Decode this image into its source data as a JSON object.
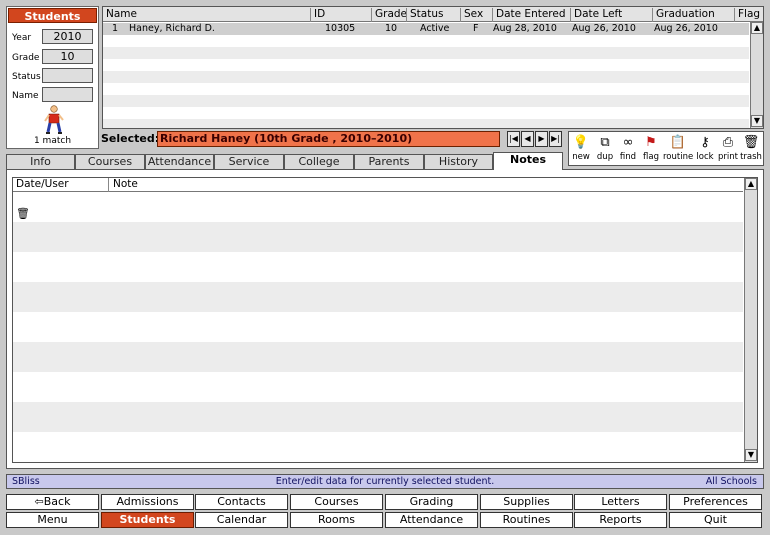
{
  "students_panel": {
    "title": "Students",
    "year_label": "Year",
    "year_value": "2010",
    "grade_label": "Grade",
    "grade_value": "10",
    "status_label": "Status",
    "status_value": "",
    "name_label": "Name",
    "name_value": "",
    "match_text": "1 match",
    "icon": "person-figure-icon"
  },
  "student_list": {
    "columns": [
      "Name",
      "ID",
      "Grade",
      "Status",
      "Sex",
      "Date Entered",
      "Date Left",
      "Graduation",
      "Flag"
    ],
    "rows": [
      {
        "num": "1",
        "name": "Haney, Richard D.",
        "id": "10305",
        "grade": "10",
        "status": "Active",
        "sex": "F",
        "entered": "Aug 28, 2010",
        "left": "Aug 26, 2010",
        "graduation": "Aug 26, 2010",
        "flag": ""
      }
    ]
  },
  "selected": {
    "label": "Selected:",
    "value": "Richard Haney (10th Grade , 2010–2010)"
  },
  "record_nav": [
    "first-record-icon",
    "previous-record-icon",
    "next-record-icon",
    "last-record-icon"
  ],
  "toolbar": [
    {
      "label": "new",
      "icon": "lightbulb-icon"
    },
    {
      "label": "dup",
      "icon": "duplicate-icon"
    },
    {
      "label": "find",
      "icon": "glasses-icon"
    },
    {
      "label": "flag",
      "icon": "flag-icon"
    },
    {
      "label": "routine",
      "icon": "clipboard-icon"
    },
    {
      "label": "lock",
      "icon": "key-icon"
    },
    {
      "label": "print",
      "icon": "printer-icon"
    },
    {
      "label": "trash",
      "icon": "trash-icon"
    }
  ],
  "tabs": [
    "Info",
    "Courses",
    "Attendance",
    "Service",
    "College",
    "Parents",
    "History",
    "Notes"
  ],
  "active_tab": "Notes",
  "notes": {
    "columns": [
      "Date/User",
      "Note"
    ],
    "row_icon": "trash-icon"
  },
  "status_bar": {
    "left": "SBliss",
    "center": "Enter/edit data for currently selected student.",
    "right": "All Schools"
  },
  "bottom_buttons": {
    "row1": [
      "Back",
      "Admissions",
      "Contacts",
      "Courses",
      "Grading",
      "Supplies",
      "Letters",
      "Preferences"
    ],
    "row2": [
      "Menu",
      "Students",
      "Calendar",
      "Rooms",
      "Attendance",
      "Routines",
      "Reports",
      "Quit"
    ]
  },
  "colors": {
    "accent": "#d2461e",
    "selected_box": "#f0734a",
    "status_bar": "#c8c8ec",
    "background": "#c9c9c9"
  }
}
